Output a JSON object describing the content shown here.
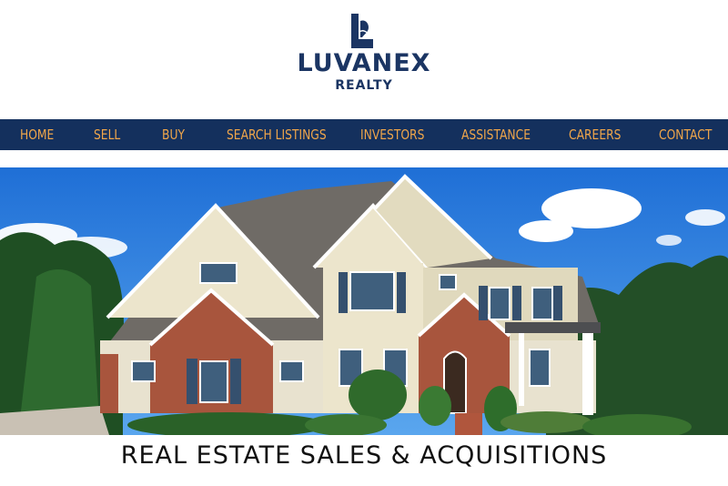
{
  "brand": {
    "name": "LUVANEX",
    "sub": "REALTY"
  },
  "nav": {
    "items": [
      {
        "label": "HOME"
      },
      {
        "label": "SELL"
      },
      {
        "label": "BUY"
      },
      {
        "label": "SEARCH LISTINGS"
      },
      {
        "label": "INVESTORS"
      },
      {
        "label": "ASSISTANCE"
      },
      {
        "label": "CAREERS"
      },
      {
        "label": "CONTACT"
      }
    ]
  },
  "hero": {
    "image": "house-photo"
  },
  "tagline": "REAL ESTATE SALES & ACQUISITIONS",
  "colors": {
    "navy": "#14305d",
    "nav_text": "#f0a64a",
    "brand": "#1b3563"
  }
}
